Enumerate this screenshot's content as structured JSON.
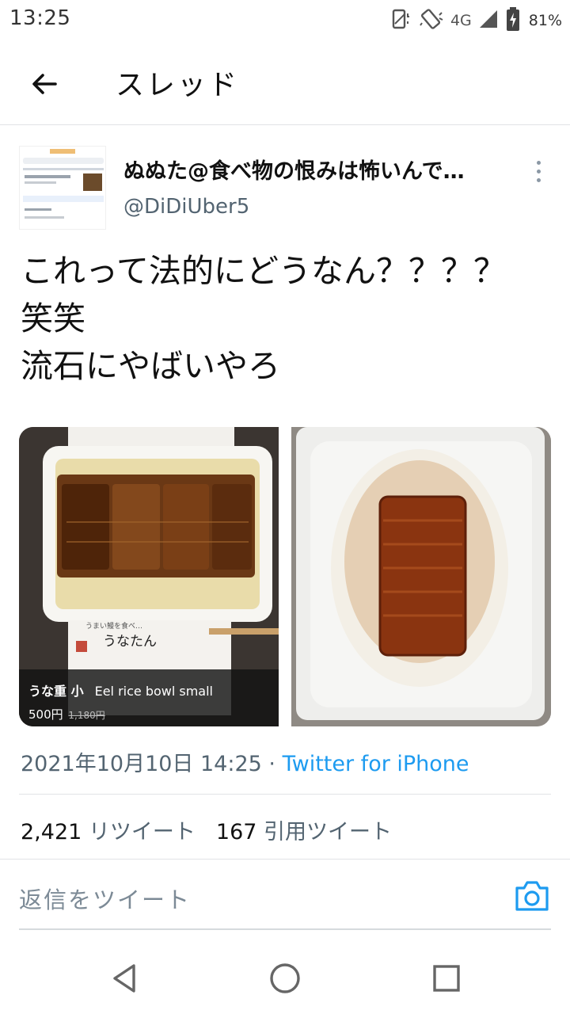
{
  "status_bar": {
    "time": "13:25",
    "network": "4G",
    "battery": "81%",
    "icons": [
      "vibrate-icon",
      "rotate-icon",
      "signal-icon",
      "battery-charging-icon"
    ]
  },
  "appbar": {
    "title": "スレッド",
    "back_icon": "arrow-left-icon"
  },
  "tweet": {
    "author_name": "ぬぬた@食べ物の恨みは怖いんで…",
    "author_handle": "@DiDiUber5",
    "text_lines": [
      "これって法的にどうなん？？？？",
      "笑笑",
      "流石にやばいやろ"
    ],
    "media": [
      {
        "caption_title": "うな重 小",
        "caption_title_en": "Eel rice bowl small",
        "price": "500円",
        "price_original": "1,180円"
      },
      {}
    ],
    "date": "2021年10月10日 14:25",
    "separator": "·",
    "source": "Twitter for iPhone",
    "retweets_count": "2,421",
    "retweets_label": "リツイート",
    "quotes_count": "167",
    "quotes_label": "引用ツイート"
  },
  "reply": {
    "placeholder": "返信をツイート",
    "camera_icon": "camera-icon"
  },
  "navbar": {
    "icons": [
      "back-triangle-icon",
      "home-circle-icon",
      "recents-square-icon"
    ]
  },
  "colors": {
    "accent": "#1d9bf0",
    "secondary_text": "#536471",
    "divider": "#e1e3e6"
  }
}
